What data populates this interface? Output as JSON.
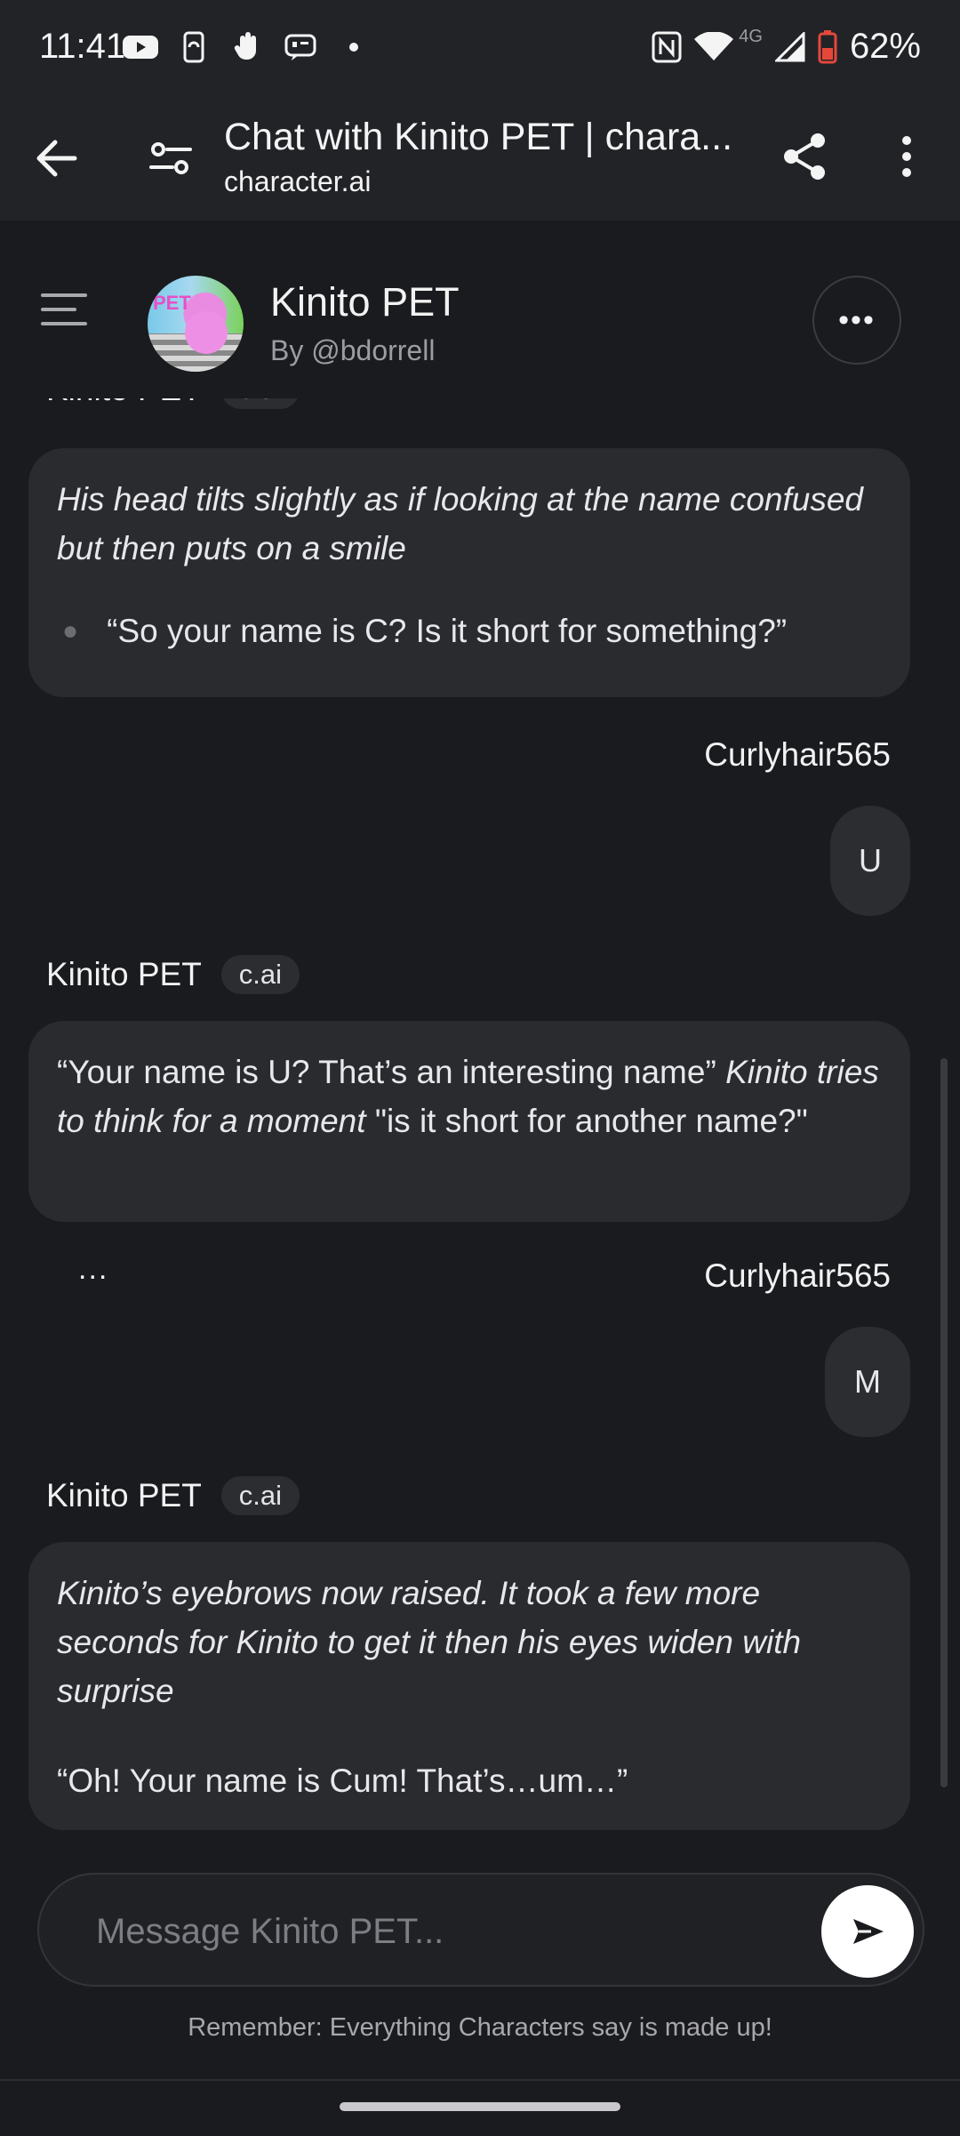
{
  "status": {
    "time": "11:41",
    "network": "4G",
    "battery": "62%",
    "left_icons": [
      "youtube-icon",
      "phone-sync-icon",
      "hand-icon",
      "message-icon",
      "dot-icon"
    ]
  },
  "browser": {
    "title": "Chat with Kinito PET | chara...",
    "url": "character.ai"
  },
  "character": {
    "name": "Kinito PET",
    "author": "By @bdorrell",
    "avatar_text": "PET"
  },
  "messages": [
    {
      "sender": "Kinito PET",
      "badge": "c.ai",
      "italic": "His head tilts slightly as if looking at the name confused but then puts on a smile",
      "bullet": "“So your name is C? Is it short for something?”"
    },
    {
      "user": "Curlyhair565",
      "text": "U"
    },
    {
      "sender": "Kinito PET",
      "badge": "c.ai",
      "part1": "“Your name is U? That’s an interesting name” ",
      "part2_italic": "Kinito tries to think for a moment",
      "part3": " \"is it short for another name?\""
    },
    {
      "user": "Curlyhair565",
      "text": "M",
      "dots": "..."
    },
    {
      "sender": "Kinito PET",
      "badge": "c.ai",
      "italic": "Kinito’s eyebrows now raised. It took a few more seconds for Kinito to get it then his eyes widen with surprise",
      "text": "“Oh! Your name is Cum! That’s…um…”"
    }
  ],
  "input": {
    "placeholder": "Message Kinito PET..."
  },
  "disclaimer": "Remember: Everything Characters say is made up!",
  "colors": {
    "background": "#1a1b1e",
    "bar": "#222327",
    "bubble": "#2a2b2f",
    "battery": "#e5483b"
  }
}
